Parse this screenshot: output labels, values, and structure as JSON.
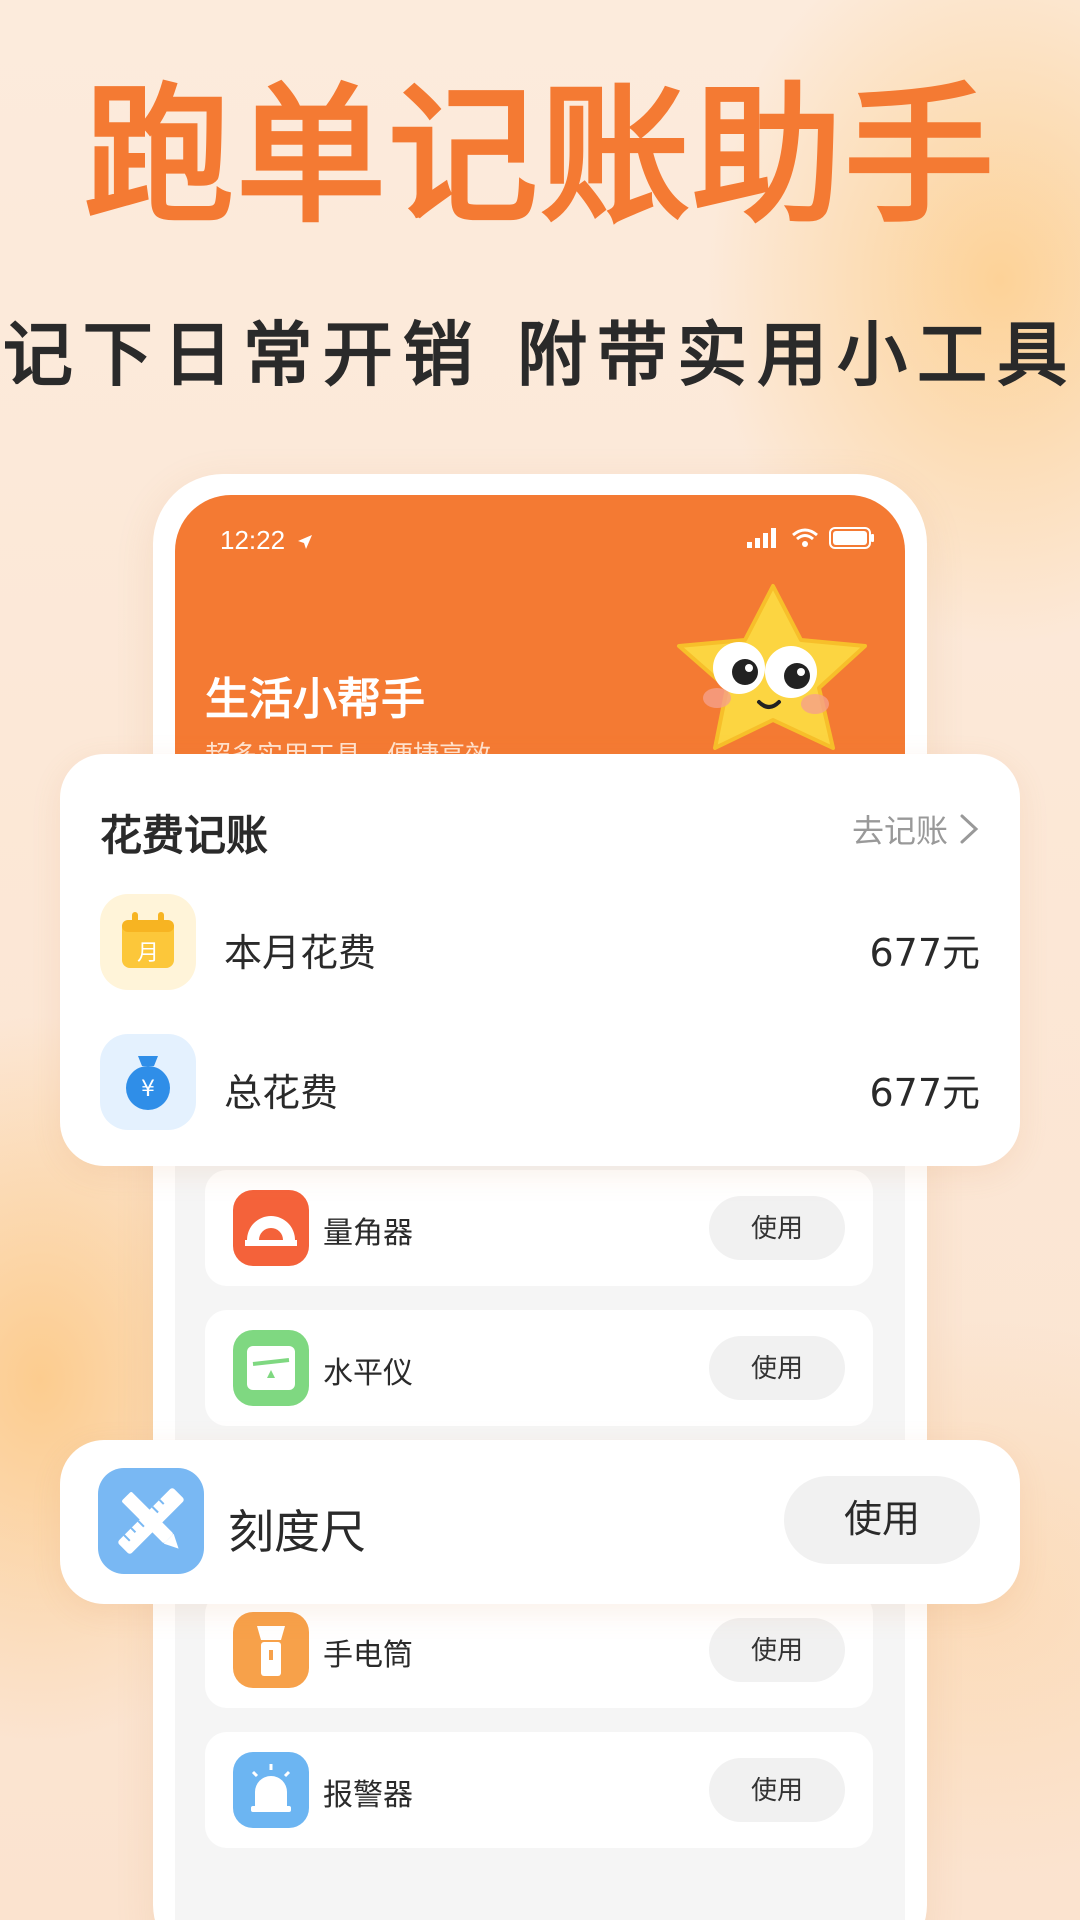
{
  "hero": {
    "title": "跑单记账助手",
    "subtitle": "记下日常开销 附带实用小工具"
  },
  "phone": {
    "status_time": "12:22",
    "header_title": "生活小帮手",
    "header_subtitle": "超多实用工具，便捷高效"
  },
  "expense": {
    "title": "花费记账",
    "link_label": "去记账",
    "rows": [
      {
        "label": "本月花费",
        "value": "677元",
        "icon": "calendar-icon",
        "icon_text": "月"
      },
      {
        "label": "总花费",
        "value": "677元",
        "icon": "money-bag-icon",
        "icon_text": "¥"
      }
    ]
  },
  "tools": [
    {
      "name": "量角器",
      "button": "使用",
      "icon": "protractor-icon",
      "color": "#f4623a"
    },
    {
      "name": "水平仪",
      "button": "使用",
      "icon": "level-icon",
      "color": "#7fd881"
    },
    {
      "name": "手电筒",
      "button": "使用",
      "icon": "flashlight-icon",
      "color": "#f7a14a"
    },
    {
      "name": "报警器",
      "button": "使用",
      "icon": "alarm-icon",
      "color": "#6cb5f2"
    }
  ],
  "featured_tool": {
    "name": "刻度尺",
    "button": "使用",
    "icon": "ruler-icon",
    "color": "#79b8f3"
  },
  "colors": {
    "accent": "#f47a33",
    "background": "#fbeadb"
  }
}
